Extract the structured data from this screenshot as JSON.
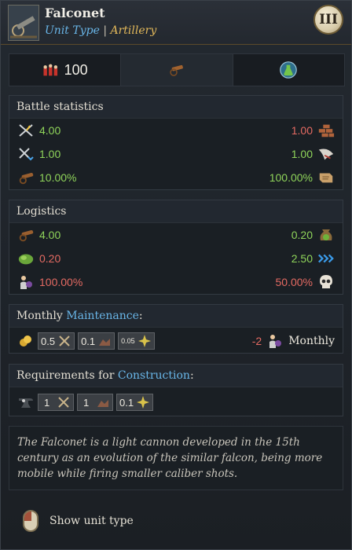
{
  "header": {
    "title": "Falconet",
    "subtitle_type": "Unit Type",
    "subtitle_sep": "|",
    "subtitle_value": "Artillery",
    "tier": "III"
  },
  "tabs": [
    {
      "icon": "soldiers-icon",
      "value": "100"
    },
    {
      "icon": "cannon-icon"
    },
    {
      "icon": "potion-icon"
    }
  ],
  "battle": {
    "title": "Battle statistics",
    "rows": [
      {
        "left": "4.00",
        "right": "1.00"
      },
      {
        "left": "1.00",
        "right": "1.00"
      },
      {
        "left": "10.00%",
        "right": "100.00%"
      }
    ]
  },
  "logistics": {
    "title": "Logistics",
    "rows": [
      {
        "left": "4.00",
        "right": "0.20"
      },
      {
        "left": "0.20",
        "right": "2.50"
      },
      {
        "left": "100.00%",
        "right": "50.00%"
      }
    ]
  },
  "maintenance": {
    "title_prefix": "Monthly",
    "title_highlight": "Maintenance",
    "title_suffix": ":",
    "chips": [
      "0.5",
      "0.1",
      "0.05"
    ],
    "cost": "-2",
    "period": "Monthly"
  },
  "construction": {
    "title_prefix": "Requirements for",
    "title_highlight": "Construction",
    "title_suffix": ":",
    "chips": [
      "1",
      "1",
      "0.1"
    ]
  },
  "description": "The Falconet is a light cannon developed in the 15th century as an evolution of the similar falcon, being more mobile while firing smaller caliber shots.",
  "footer": {
    "label": "Show unit type"
  },
  "colors": {
    "accent_blue": "#69b6e8",
    "accent_gold": "#e3b95a",
    "positive": "#8fd45a",
    "negative": "#e46a62"
  }
}
